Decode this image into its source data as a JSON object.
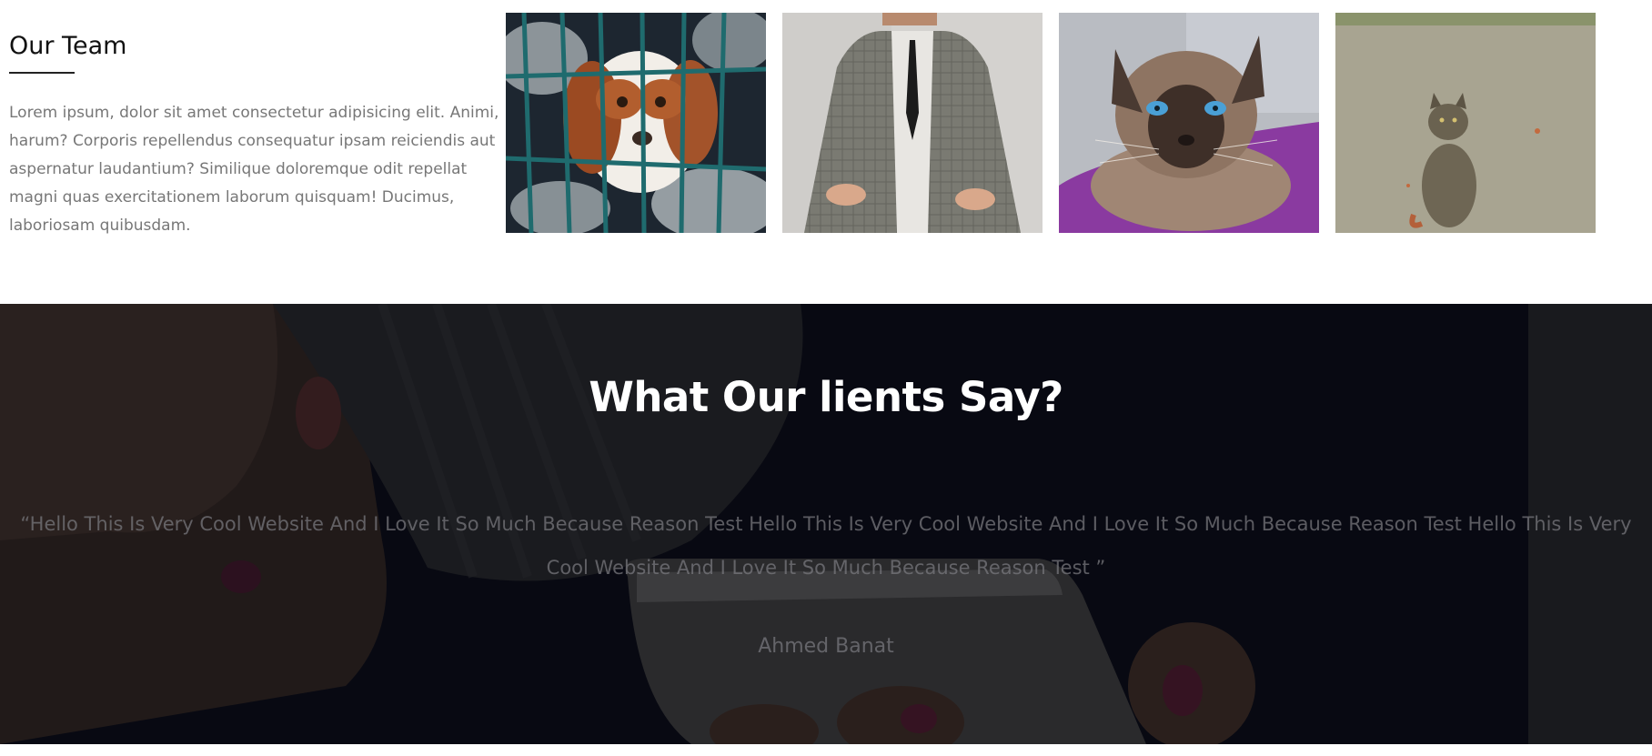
{
  "team": {
    "title": "Our Team",
    "description": "Lorem ipsum, dolor sit amet consectetur adipisicing elit. Animi, harum? Corporis repellendus consequatur ipsam reiciendis aut aspernatur laudantium? Similique doloremque odit repellat magni quas exercitationem laborum quisquam! Ducimus, laboriosam quibusdam.",
    "photos": [
      {
        "subject": "dog-behind-fence"
      },
      {
        "subject": "woman-in-blazer"
      },
      {
        "subject": "siamese-cat-on-purple-blanket"
      },
      {
        "subject": "gray-cat-on-road"
      }
    ]
  },
  "testimonials": {
    "title": "What Our lients Say?",
    "quote": "“Hello This Is Very Cool Website And I Love It So Much Because Reason Test Hello This Is Very Cool Website And I Love It So Much Because Reason Test Hello This Is Very Cool Website And I Love It So Much Because Reason Test ”",
    "author": "Ahmed Banat",
    "background_subject": "hands-holding-phone"
  }
}
